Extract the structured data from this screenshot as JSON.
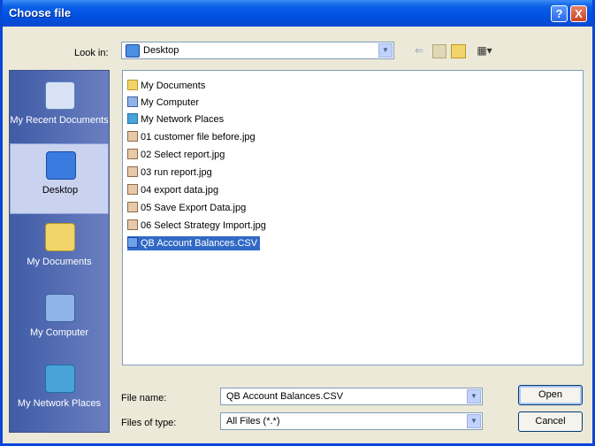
{
  "window": {
    "title": "Choose file"
  },
  "titlebar_buttons": {
    "help": "?",
    "close": "X"
  },
  "lookin": {
    "label": "Look in:",
    "value": "Desktop"
  },
  "places": [
    {
      "label": "My Recent Documents",
      "icon": "recent-documents-icon"
    },
    {
      "label": "Desktop",
      "icon": "desktop-icon"
    },
    {
      "label": "My Documents",
      "icon": "my-documents-icon"
    },
    {
      "label": "My Computer",
      "icon": "my-computer-icon"
    },
    {
      "label": "My Network Places",
      "icon": "network-places-icon"
    }
  ],
  "files": [
    {
      "name": "My Documents"
    },
    {
      "name": "My Computer"
    },
    {
      "name": "My Network Places"
    },
    {
      "name": "01 customer file before.jpg"
    },
    {
      "name": "02 Select report.jpg"
    },
    {
      "name": "03 run report.jpg"
    },
    {
      "name": "04 export data.jpg"
    },
    {
      "name": "05 Save Export Data.jpg"
    },
    {
      "name": "06 Select Strategy Import.jpg"
    },
    {
      "name": "QB Account Balances.CSV"
    }
  ],
  "selected_file": "QB Account Balances.CSV",
  "filename": {
    "label": "File name:",
    "value": "QB Account Balances.CSV"
  },
  "filetype": {
    "label": "Files of type:",
    "value": "All Files (*.*)"
  },
  "buttons": {
    "open": "Open",
    "cancel": "Cancel"
  },
  "colors": {
    "titlebar": "#0a5fe6",
    "selection": "#316ac5",
    "places_bar": "#5a6fa8"
  }
}
